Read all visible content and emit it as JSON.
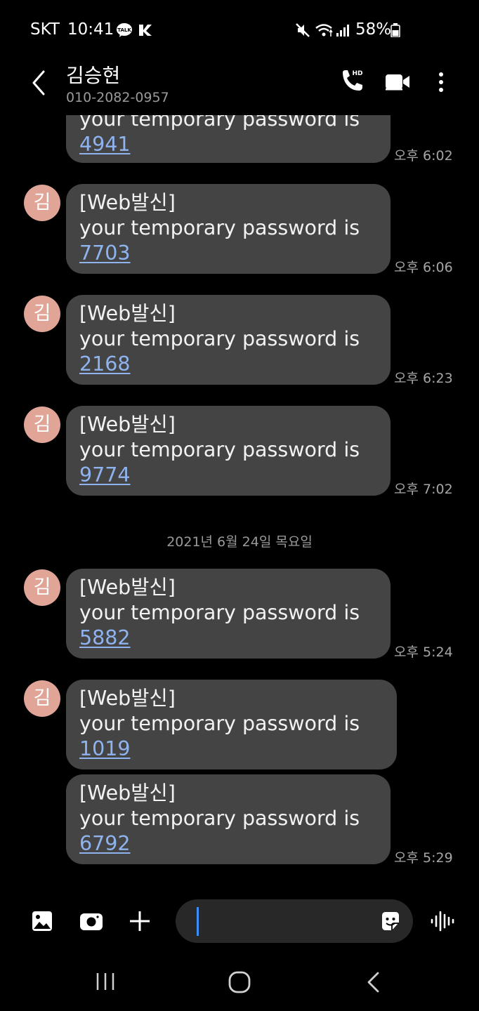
{
  "status_bar": {
    "carrier": "SKT",
    "time": "10:41",
    "battery": "58%"
  },
  "header": {
    "contact_name": "김승현",
    "contact_number": "010-2082-0957",
    "hd_badge": "HD"
  },
  "messages": [
    {
      "prefix": "",
      "body": "your temporary password is",
      "code": "4941",
      "time": "오후 6:02",
      "avatar": ""
    },
    {
      "prefix": "[Web발신]",
      "body": "your temporary password is",
      "code": "7703",
      "time": "오후 6:06",
      "avatar": "김"
    },
    {
      "prefix": "[Web발신]",
      "body": "your temporary password is",
      "code": "2168",
      "time": "오후 6:23",
      "avatar": "김"
    },
    {
      "prefix": "[Web발신]",
      "body": "your temporary password is",
      "code": "9774",
      "time": "오후 7:02",
      "avatar": "김"
    },
    {
      "prefix": "[Web발신]",
      "body": "your temporary password is",
      "code": "5882",
      "time": "오후 5:24",
      "avatar": "김"
    },
    {
      "prefix": "[Web발신]",
      "body": "your temporary password is",
      "code": "1019",
      "time": "",
      "avatar": "김"
    },
    {
      "prefix": "[Web발신]",
      "body": "your temporary password is",
      "code": "6792",
      "time": "오후 5:29",
      "avatar": ""
    }
  ],
  "date_separator": "2021년 6월 24일 목요일",
  "composer": {
    "input_value": ""
  },
  "colors": {
    "background": "#000000",
    "bubble": "#444444",
    "link": "#8fb3ee",
    "avatar": "#e0a597",
    "cursor": "#3e8ef7"
  },
  "icons": [
    "back-arrow-icon",
    "hd-call-icon",
    "video-call-icon",
    "more-options-icon",
    "gallery-icon",
    "camera-icon",
    "add-icon",
    "sticker-icon",
    "voice-record-icon",
    "recent-apps-icon",
    "home-icon",
    "nav-back-icon"
  ]
}
